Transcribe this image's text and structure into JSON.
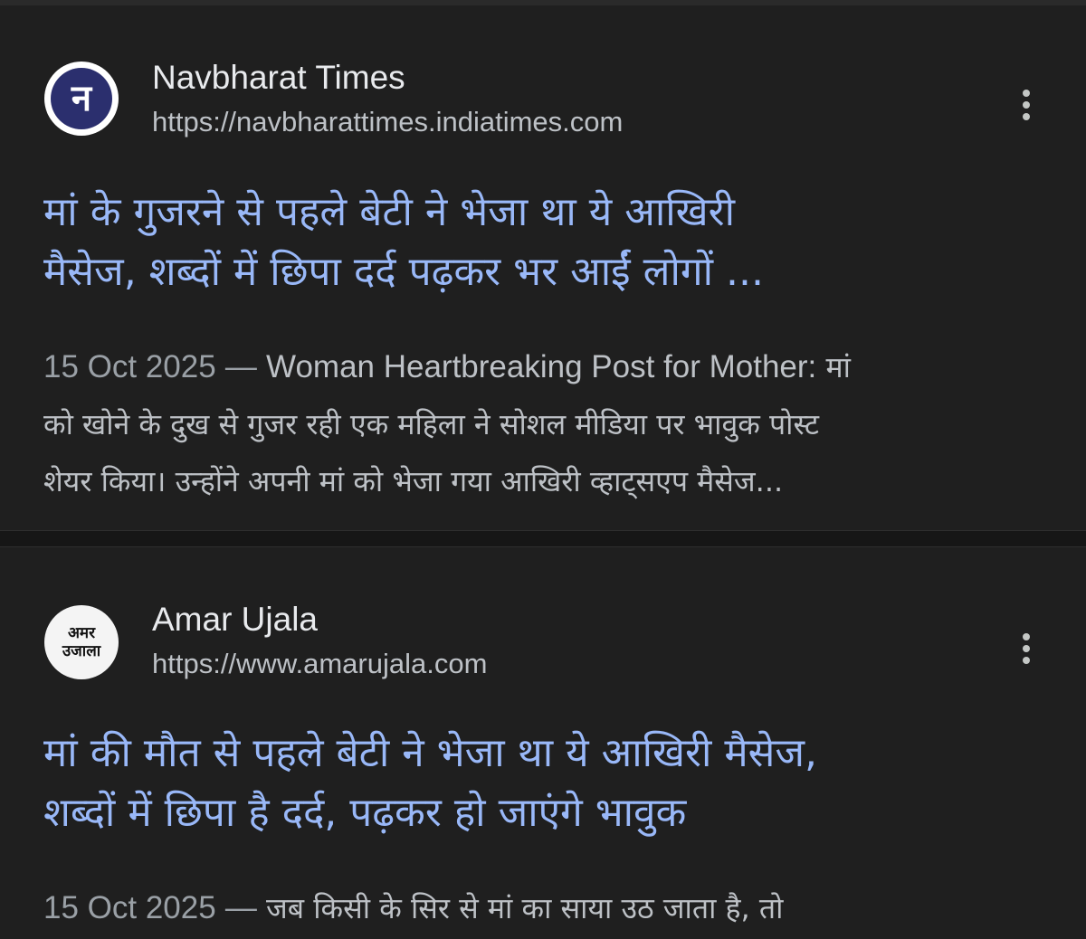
{
  "results": [
    {
      "favicon": {
        "icon": "navbharat-times-logo",
        "glyph": "न",
        "bg_color": "#2b2f6e"
      },
      "site_name": "Navbharat Times",
      "url": "https://navbharattimes.indiatimes.com",
      "title_lines": [
        "मां के गुजरने से पहले बेटी ने भेजा था ये आखिरी",
        "मैसेज, शब्दों में छिपा दर्द पढ़कर भर आईं लोगों ..."
      ],
      "date": "15 Oct 2025",
      "separator": "—",
      "snippet_en": "Woman Heartbreaking Post for Mother:",
      "snippet_lines": [
        "मां",
        "को खोने के दुख से गुजर रही एक महिला ने सोशल मीडिया पर भावुक पोस्ट",
        "शेयर किया। उन्होंने अपनी मां को भेजा गया आखिरी व्हाट्सएप मैसेज..."
      ]
    },
    {
      "favicon": {
        "icon": "amar-ujala-logo",
        "line1": "अमर",
        "line2": "उजाला",
        "bg_color": "#f4f4f4"
      },
      "site_name": "Amar Ujala",
      "url": "https://www.amarujala.com",
      "title_lines": [
        "मां की मौत से पहले बेटी ने भेजा था ये आखिरी मैसेज,",
        "शब्दों में छिपा है दर्द, पढ़कर हो जाएंगे भावुक"
      ],
      "date": "15 Oct 2025",
      "separator": "—",
      "snippet_lines": [
        "जब किसी के सिर से मां का साया उठ जाता है, तो"
      ]
    }
  ],
  "colors": {
    "background": "#1f1f1f",
    "title_link": "#99b8f8",
    "site_name": "#e8eaed",
    "url": "#bdc1c6",
    "date": "#9aa0a6"
  },
  "icons": {
    "more_options": "more-vert-icon"
  }
}
